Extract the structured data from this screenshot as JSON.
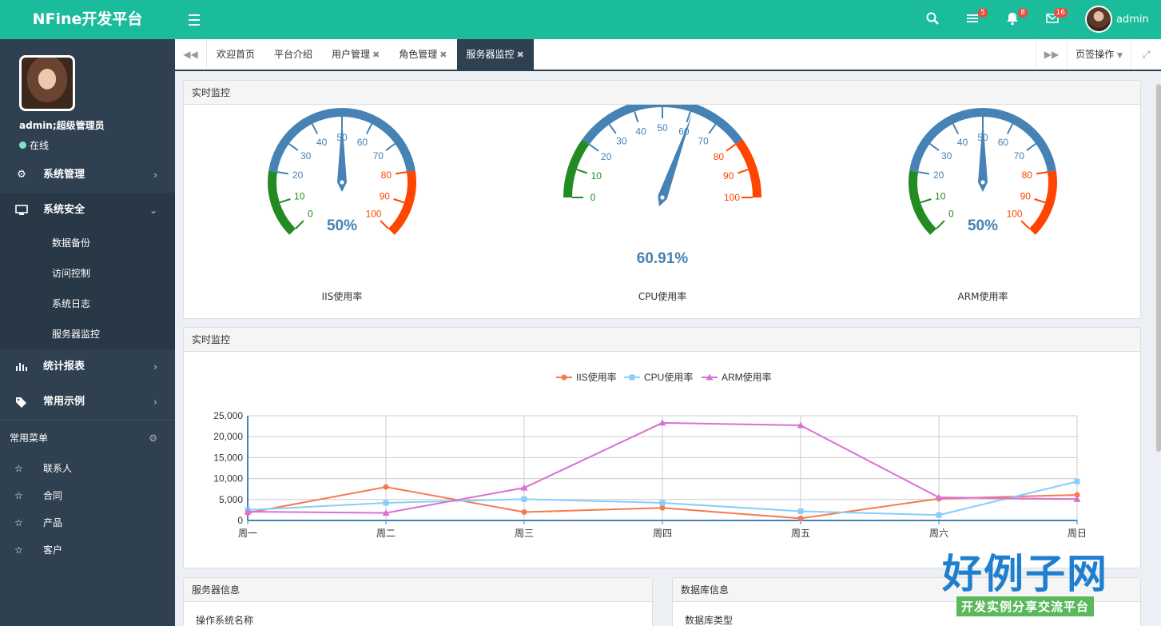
{
  "app": {
    "title": "NFine开发平台"
  },
  "topbar": {
    "badges": {
      "messages": "5",
      "notifications": "8",
      "mail": "16"
    },
    "username": "admin"
  },
  "sidebar": {
    "user_name": "admin;超级管理员",
    "status": "在线",
    "menu": [
      {
        "label": "系统管理",
        "icon": "cogs-icon"
      },
      {
        "label": "系统安全",
        "icon": "monitor-icon",
        "expanded": true,
        "children": [
          "数据备份",
          "访问控制",
          "系统日志",
          "服务器监控"
        ]
      },
      {
        "label": "统计报表",
        "icon": "bar-chart-icon"
      },
      {
        "label": "常用示例",
        "icon": "tags-icon"
      }
    ],
    "common_menu_title": "常用菜单",
    "common_items": [
      "联系人",
      "合同",
      "产品",
      "客户"
    ]
  },
  "tabs": {
    "items": [
      "欢迎首页",
      "平台介绍",
      "用户管理",
      "角色管理",
      "服务器监控"
    ],
    "closable": [
      false,
      false,
      true,
      true,
      true
    ],
    "active_index": 4,
    "tab_ops": "页签操作"
  },
  "monitor": {
    "panel_title": "实时监控",
    "gauges": [
      {
        "name": "IIS使用率",
        "value": 50,
        "display": "50%"
      },
      {
        "name": "CPU使用率",
        "value": 60.91,
        "display": "60.91%"
      },
      {
        "name": "ARM使用率",
        "value": 50,
        "display": "50%"
      }
    ],
    "gauge_ticks": [
      "0",
      "10",
      "20",
      "30",
      "40",
      "50",
      "60",
      "70",
      "80",
      "90",
      "100"
    ]
  },
  "trend": {
    "panel_title": "实时监控"
  },
  "chart_data": {
    "type": "line",
    "categories": [
      "周一",
      "周二",
      "周三",
      "周四",
      "周五",
      "周六",
      "周日"
    ],
    "series": [
      {
        "name": "IIS使用率",
        "color": "#f47b50",
        "marker": "circle",
        "values": [
          1800,
          8000,
          2000,
          3000,
          500,
          5200,
          6100
        ]
      },
      {
        "name": "CPU使用率",
        "color": "#87cefa",
        "marker": "square",
        "values": [
          2500,
          4200,
          5100,
          4200,
          2200,
          1300,
          9300
        ]
      },
      {
        "name": "ARM使用率",
        "color": "#da70d6",
        "marker": "triangle",
        "values": [
          2100,
          1800,
          7800,
          23300,
          22700,
          5500,
          5100
        ]
      }
    ],
    "yticks": [
      "0",
      "5,000",
      "10,000",
      "15,000",
      "20,000",
      "25,000"
    ],
    "ylim": [
      0,
      25000
    ],
    "legend": "top-center",
    "grid": true
  },
  "server_info": {
    "title": "服务器信息",
    "first_label": "操作系统名称"
  },
  "db_info": {
    "title": "数据库信息",
    "first_label": "数据库类型"
  },
  "watermark": {
    "big": "好例子网",
    "small": "开发实例分享交流平台"
  },
  "colors": {
    "brand": "#1abc9c",
    "sidebar": "#2f4050",
    "gauge_blue": "#4682b4",
    "gauge_green": "#228b22",
    "gauge_red": "#ff4500"
  }
}
